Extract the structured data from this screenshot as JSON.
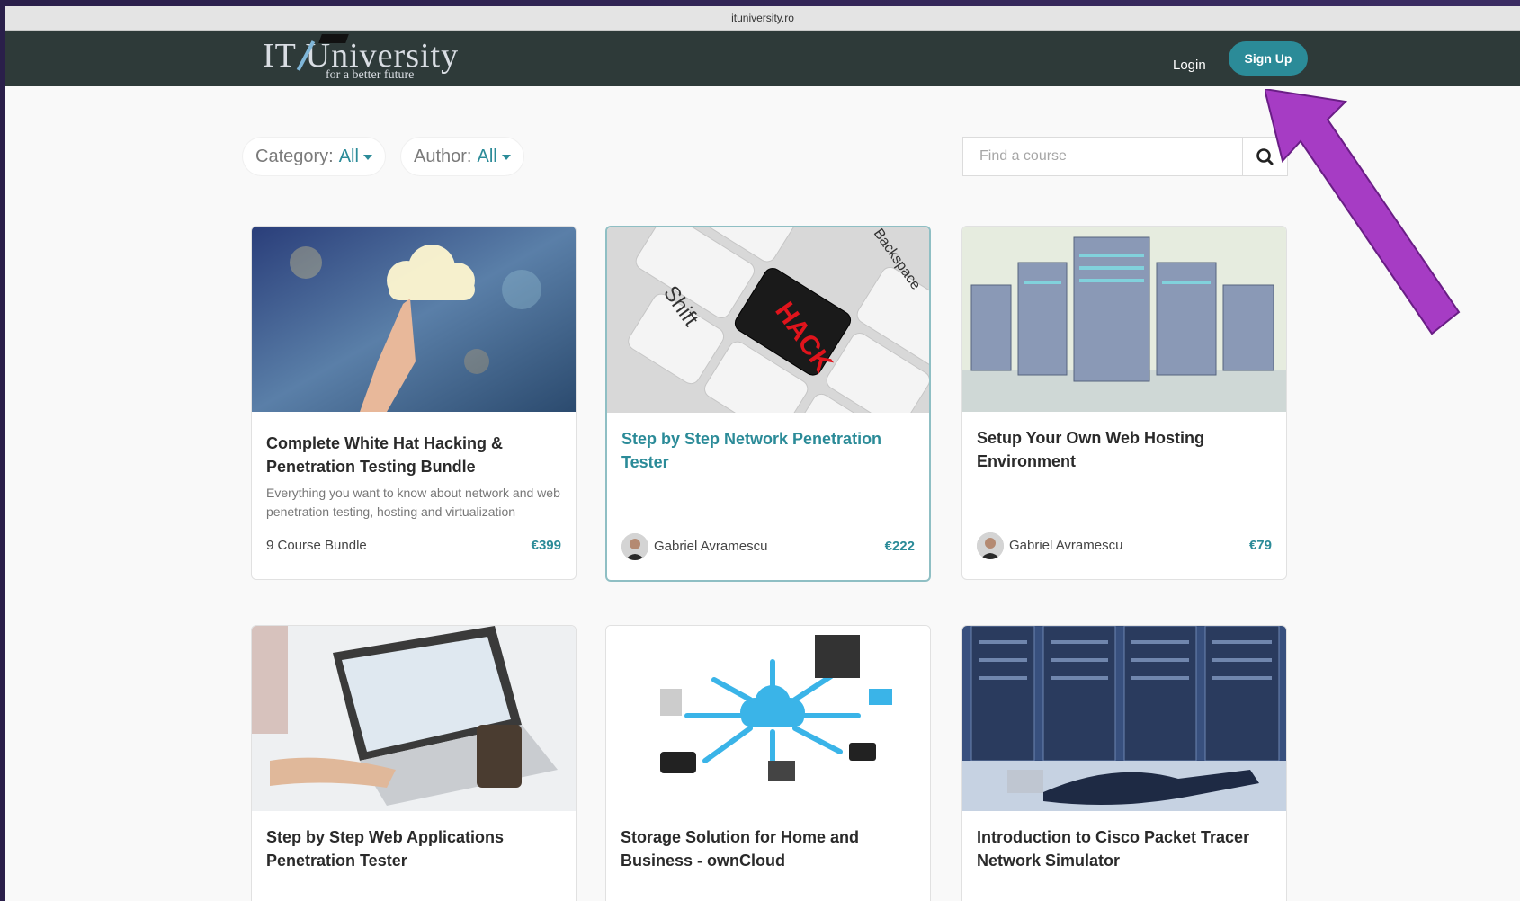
{
  "browser": {
    "url": "ituniversity.ro"
  },
  "navbar": {
    "logo_text": "IT University",
    "logo_tagline": "for a better future",
    "login_label": "Login",
    "signup_label": "Sign Up"
  },
  "filters": {
    "category_label": "Category:",
    "category_value": "All",
    "author_label": "Author:",
    "author_value": "All"
  },
  "search": {
    "placeholder": "Find a course"
  },
  "courses": [
    {
      "title": "Complete White Hat Hacking & Penetration Testing Bundle",
      "description": "Everything you want to know about network and web penetration testing, hosting and virtualization",
      "author": "9 Course Bundle",
      "price": "€399"
    },
    {
      "title": "Step by Step Network Penetration Tester",
      "author": "Gabriel Avramescu",
      "price": "€222"
    },
    {
      "title": "Setup Your Own Web Hosting Environment",
      "author": "Gabriel Avramescu",
      "price": "€79"
    },
    {
      "title": "Step by Step Web Applications Penetration Tester"
    },
    {
      "title": "Storage Solution for Home and Business - ownCloud"
    },
    {
      "title": "Introduction to Cisco Packet Tracer Network Simulator"
    }
  ],
  "thumbnails": {
    "hack_key_text": "HACK",
    "shift_key_text": "Shift",
    "backspace_key_text": "Backspace"
  },
  "colors": {
    "navbar": "#2e3a39",
    "accent": "#2b8b98",
    "annotation_arrow": "#a63cc4"
  },
  "annotation": {
    "icon": "arrow-pointing-to-sign-up"
  }
}
